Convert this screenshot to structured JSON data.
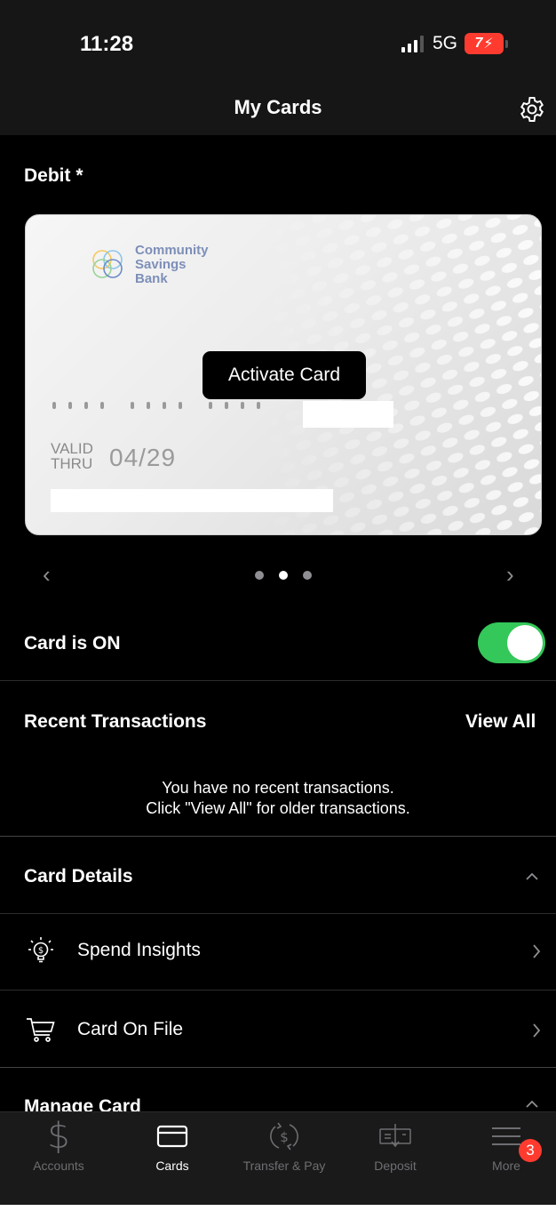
{
  "status_bar": {
    "time": "11:28",
    "network": "5G",
    "battery": "7"
  },
  "header": {
    "title": "My Cards",
    "settings_icon": "gear-icon"
  },
  "card_section": {
    "label": "Debit *",
    "bank_name_lines": [
      "Community",
      "Savings",
      "Bank"
    ],
    "activate_label": "Activate Card",
    "valid_label_line1": "VALID",
    "valid_label_line2": "THRU",
    "expiry": "04/29",
    "pager": {
      "total": 3,
      "active_index": 1
    }
  },
  "card_status": {
    "label": "Card is ON",
    "enabled": true
  },
  "recent": {
    "title": "Recent Transactions",
    "view_all": "View All",
    "empty_line1": "You have no recent transactions.",
    "empty_line2": "Click \"View All\" for older transactions."
  },
  "card_details": {
    "title": "Card Details",
    "items": [
      {
        "label": "Spend Insights",
        "icon": "lightbulb-dollar-icon"
      },
      {
        "label": "Card On File",
        "icon": "shopping-cart-icon"
      }
    ]
  },
  "manage_card": {
    "title": "Manage Card"
  },
  "tabbar": {
    "items": [
      {
        "label": "Accounts",
        "icon": "dollar-icon",
        "active": false
      },
      {
        "label": "Cards",
        "icon": "card-icon",
        "active": true
      },
      {
        "label": "Transfer & Pay",
        "icon": "transfer-pay-icon",
        "active": false
      },
      {
        "label": "Deposit",
        "icon": "deposit-check-icon",
        "active": false
      },
      {
        "label": "More",
        "icon": "menu-icon",
        "active": false
      }
    ],
    "more_badge": "3"
  },
  "colors": {
    "toggle_on": "#34c759",
    "badge": "#ff3b30",
    "battery": "#ff3b30",
    "bank_text": "#7d8fb8"
  }
}
